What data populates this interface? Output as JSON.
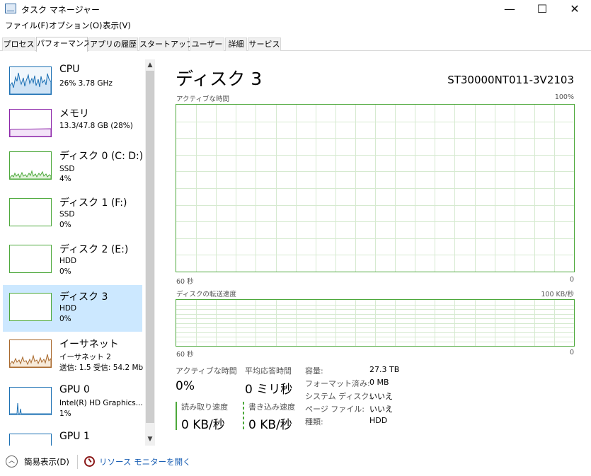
{
  "window": {
    "title": "タスク マネージャー",
    "minimize": "—",
    "maximize": "☐",
    "close": "✕"
  },
  "menu": [
    "ファイル(F)",
    "オプション(O)",
    "表示(V)"
  ],
  "tabs": [
    "プロセス",
    "パフォーマンス",
    "アプリの履歴",
    "スタートアップ",
    "ユーザー",
    "詳細",
    "サービス"
  ],
  "active_tab": "パフォーマンス",
  "sidebar": {
    "items": [
      {
        "name": "CPU",
        "line1": "26%  3.78 GHz",
        "line2": "",
        "color": "#1a6fb3",
        "icon": "cpu-graph-icon"
      },
      {
        "name": "メモリ",
        "line1": "13.3/47.8 GB (28%)",
        "line2": "",
        "color": "#8b23a8",
        "icon": "memory-graph-icon"
      },
      {
        "name": "ディスク 0 (C: D:)",
        "line1": "SSD",
        "line2": "4%",
        "color": "#4ca83a",
        "icon": "disk-graph-icon"
      },
      {
        "name": "ディスク 1 (F:)",
        "line1": "SSD",
        "line2": "0%",
        "color": "#4ca83a",
        "icon": "disk-graph-icon"
      },
      {
        "name": "ディスク 2 (E:)",
        "line1": "HDD",
        "line2": "0%",
        "color": "#4ca83a",
        "icon": "disk-graph-icon"
      },
      {
        "name": "ディスク 3",
        "line1": "HDD",
        "line2": "0%",
        "color": "#4ca83a",
        "icon": "disk-graph-icon"
      },
      {
        "name": "イーサネット",
        "line1": "イーサネット 2",
        "line2": "送信: 1.5  受信: 54.2 Mb",
        "color": "#a8672a",
        "icon": "network-graph-icon"
      },
      {
        "name": "GPU 0",
        "line1": "Intel(R) HD Graphics...",
        "line2": "1%",
        "color": "#1a6fb3",
        "icon": "gpu-graph-icon"
      },
      {
        "name": "GPU 1",
        "line1": "",
        "line2": "",
        "color": "#1a6fb3",
        "icon": "gpu-graph-icon"
      }
    ],
    "selected_index": 5
  },
  "detail": {
    "title": "ディスク 3",
    "model": "ST30000NT011-3V2103",
    "graph1": {
      "label": "アクティブな時間",
      "max": "100%",
      "x_left": "60 秒",
      "x_right": "0"
    },
    "graph2": {
      "label": "ディスクの転送速度",
      "max": "100 KB/秒",
      "x_left": "60 秒",
      "x_right": "0"
    },
    "stats": {
      "active_label": "アクティブな時間",
      "active_value": "0%",
      "response_label": "平均応答時間",
      "response_value": "0 ミリ秒",
      "read_label": "読み取り速度",
      "read_value": "0 KB/秒",
      "write_label": "書き込み速度",
      "write_value": "0 KB/秒"
    },
    "info": [
      {
        "key": "容量:",
        "value": "27.3 TB"
      },
      {
        "key": "フォーマット済み:",
        "value": "0 MB"
      },
      {
        "key": "システム ディスク:",
        "value": "いいえ"
      },
      {
        "key": "ページ ファイル:",
        "value": "いいえ"
      },
      {
        "key": "種類:",
        "value": "HDD"
      }
    ],
    "graph_color": "#4ca83a"
  },
  "footer": {
    "collapse_label": "簡易表示(D)",
    "monitor_link": "リソース モニターを開く"
  }
}
